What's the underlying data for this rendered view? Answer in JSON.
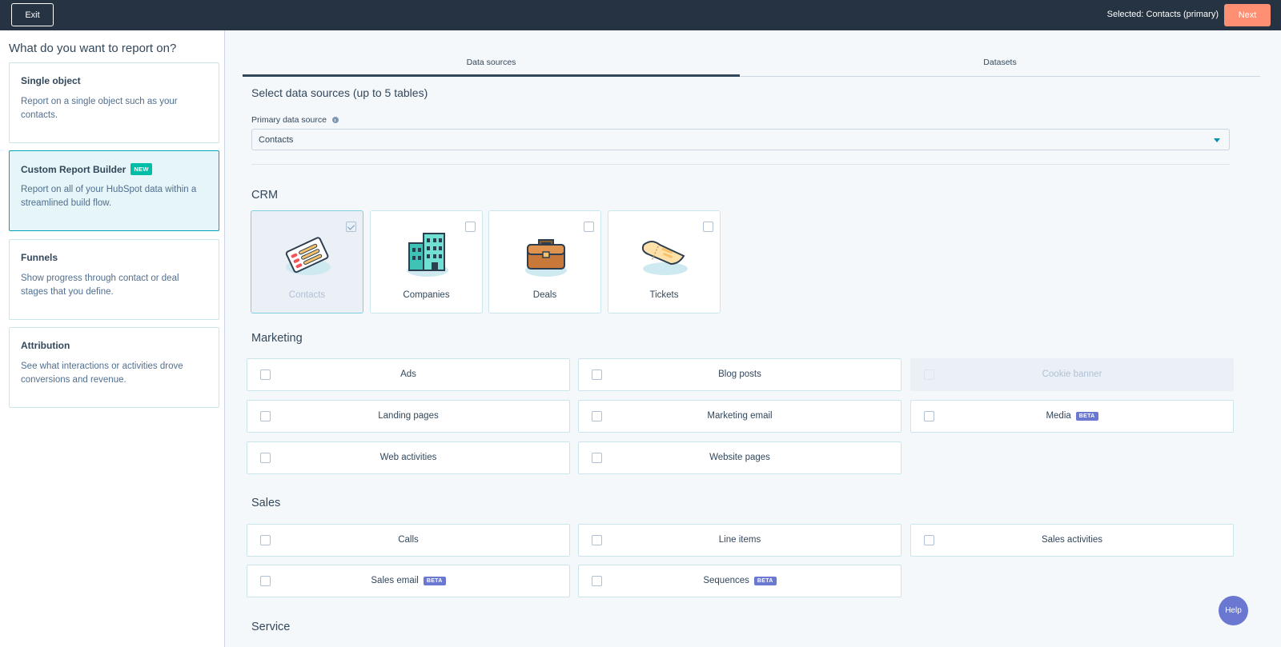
{
  "topbar": {
    "exit_label": "Exit",
    "selected_text": "Selected: Contacts (primary)",
    "next_label": "Next"
  },
  "sidebar": {
    "title": "What do you want to report on?",
    "cards": [
      {
        "title": "Single object",
        "desc": "Report on a single object such as your contacts.",
        "active": false,
        "badge": ""
      },
      {
        "title": "Custom Report Builder",
        "desc": "Report on all of your HubSpot data within a streamlined build flow.",
        "active": true,
        "badge": "NEW"
      },
      {
        "title": "Funnels",
        "desc": "Show progress through contact or deal stages that you define.",
        "active": false,
        "badge": ""
      },
      {
        "title": "Attribution",
        "desc": "See what interactions or activities drove conversions and revenue.",
        "active": false,
        "badge": ""
      }
    ]
  },
  "main": {
    "tabs": [
      {
        "label": "Data sources",
        "active": true
      },
      {
        "label": "Datasets",
        "active": false
      }
    ],
    "heading": "Select data sources (up to 5 tables)",
    "primary_label": "Primary data source",
    "primary_value": "Contacts",
    "groups": {
      "crm": {
        "heading": "CRM",
        "items": [
          {
            "label": "Contacts",
            "checked": true,
            "icon": "contacts-icon"
          },
          {
            "label": "Companies",
            "checked": false,
            "icon": "companies-icon"
          },
          {
            "label": "Deals",
            "checked": false,
            "icon": "deals-icon"
          },
          {
            "label": "Tickets",
            "checked": false,
            "icon": "tickets-icon"
          }
        ]
      },
      "marketing": {
        "heading": "Marketing",
        "items": [
          {
            "label": "Ads",
            "disabled": false,
            "badge": ""
          },
          {
            "label": "Blog posts",
            "disabled": false,
            "badge": ""
          },
          {
            "label": "Cookie banner",
            "disabled": true,
            "badge": ""
          },
          {
            "label": "Landing pages",
            "disabled": false,
            "badge": ""
          },
          {
            "label": "Marketing email",
            "disabled": false,
            "badge": ""
          },
          {
            "label": "Media",
            "disabled": false,
            "badge": "BETA"
          },
          {
            "label": "Web activities",
            "disabled": false,
            "badge": ""
          },
          {
            "label": "Website pages",
            "disabled": false,
            "badge": ""
          }
        ]
      },
      "sales": {
        "heading": "Sales",
        "items": [
          {
            "label": "Calls",
            "disabled": false,
            "badge": ""
          },
          {
            "label": "Line items",
            "disabled": false,
            "badge": ""
          },
          {
            "label": "Sales activities",
            "disabled": false,
            "badge": ""
          },
          {
            "label": "Sales email",
            "disabled": false,
            "badge": "BETA"
          },
          {
            "label": "Sequences",
            "disabled": false,
            "badge": "BETA"
          }
        ]
      },
      "service": {
        "heading": "Service"
      }
    }
  },
  "help_label": "Help"
}
